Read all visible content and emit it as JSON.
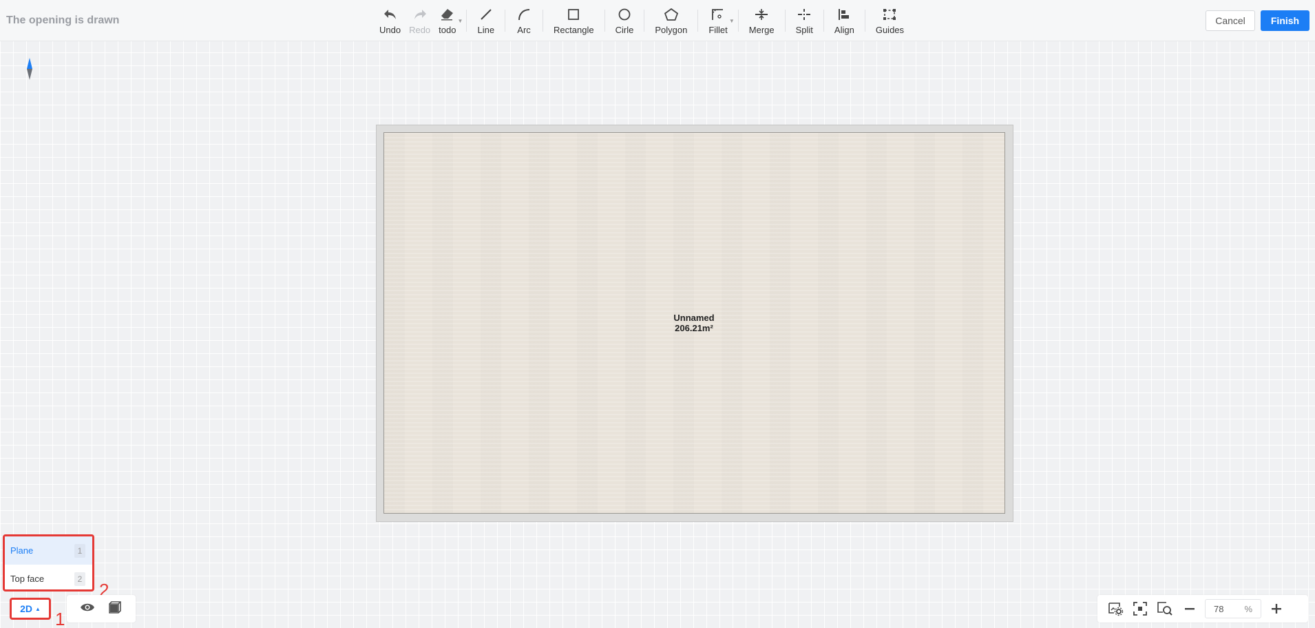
{
  "header": {
    "title": "The opening is drawn",
    "cancel_label": "Cancel",
    "finish_label": "Finish"
  },
  "toolbar": {
    "undo": "Undo",
    "redo": "Redo",
    "todo": "todo",
    "line": "Line",
    "arc": "Arc",
    "rectangle": "Rectangle",
    "circle": "Cirle",
    "polygon": "Polygon",
    "fillet": "Fillet",
    "merge": "Merge",
    "split": "Split",
    "align": "Align",
    "guides": "Guides"
  },
  "room": {
    "name": "Unnamed",
    "area": "206.21m²"
  },
  "view_menu": {
    "items": [
      {
        "label": "Plane",
        "key": "1",
        "active": true
      },
      {
        "label": "Top face",
        "key": "2",
        "active": false
      }
    ],
    "annotations": [
      "1",
      "2"
    ]
  },
  "view_mode": {
    "label": "2D"
  },
  "zoom": {
    "value": "78",
    "unit": "%"
  },
  "colors": {
    "accent": "#1c7ef5",
    "highlight": "#e53935"
  }
}
